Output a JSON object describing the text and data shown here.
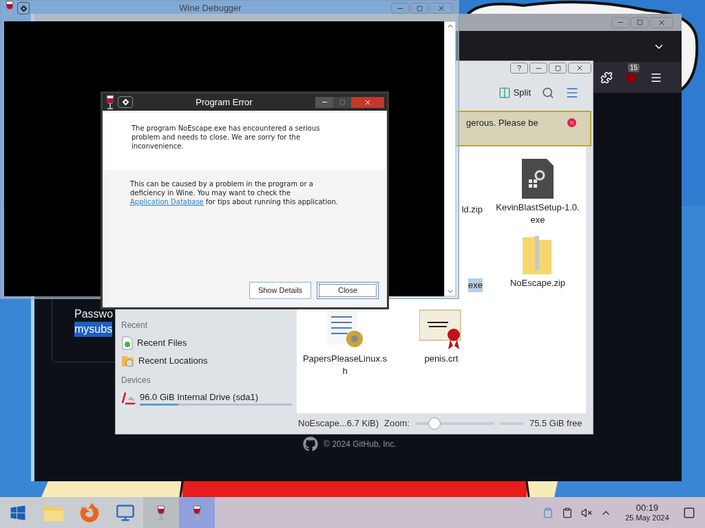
{
  "debugger": {
    "title": "Wine Debugger"
  },
  "browser": {
    "badge": "15",
    "banner": "gerous. Please be",
    "password_label": "Passwo",
    "password_value": "mysubs",
    "footer": "© 2024 GitHub, Inc."
  },
  "file_manager": {
    "title_buttons": [
      "?"
    ],
    "split": "Split",
    "places": [
      {
        "kind": "heading",
        "label": "Recent"
      },
      {
        "kind": "files",
        "label": "Recent Files"
      },
      {
        "kind": "locations",
        "label": "Recent Locations"
      },
      {
        "kind": "heading",
        "label": "Devices"
      },
      {
        "kind": "drive",
        "label": "96.0 GiB Internal Drive (sda1)",
        "level": 0.25
      }
    ],
    "files": [
      {
        "name": "ld.zip",
        "kind": "partial",
        "selected": false
      },
      {
        "name": "KevinBlastSetup-1.0.exe",
        "kind": "exe",
        "selected": false
      },
      {
        "name": "exe",
        "kind": "partial",
        "selected": true
      },
      {
        "name": "NoEscape.zip",
        "kind": "zip",
        "selected": false
      },
      {
        "name": "PapersPleaseLinux.sh",
        "kind": "script",
        "selected": false
      },
      {
        "name": "penis.crt",
        "kind": "cert",
        "selected": false
      }
    ],
    "status": "NoEscape...6.7 KiB)",
    "zoom_label": "Zoom:",
    "zoom": {
      "level": 0.2
    },
    "free": "75.5 GiB free"
  },
  "dialog": {
    "title": "Program Error",
    "message": "The program NoEscape.exe has encountered a serious problem and needs to close. We are sorry for the inconvenience.",
    "detail_before": "This can be caused by a problem in the program or a deficiency in Wine. You may want to check the",
    "link": "Application Database",
    "detail_after": "for tips about running this application.",
    "buttons": [
      {
        "label": "Show Details",
        "selected": false
      },
      {
        "label": "Close",
        "selected": true
      }
    ]
  },
  "taskbar": {
    "apps": [
      {
        "kind": "start",
        "selected": false
      },
      {
        "kind": "folder",
        "selected": false
      },
      {
        "kind": "firefox",
        "selected": false
      },
      {
        "kind": "remote",
        "selected": false
      },
      {
        "kind": "wine",
        "selected": false
      },
      {
        "kind": "wine",
        "selected": true
      }
    ],
    "time": "00:19",
    "date": "25 May 2024"
  }
}
